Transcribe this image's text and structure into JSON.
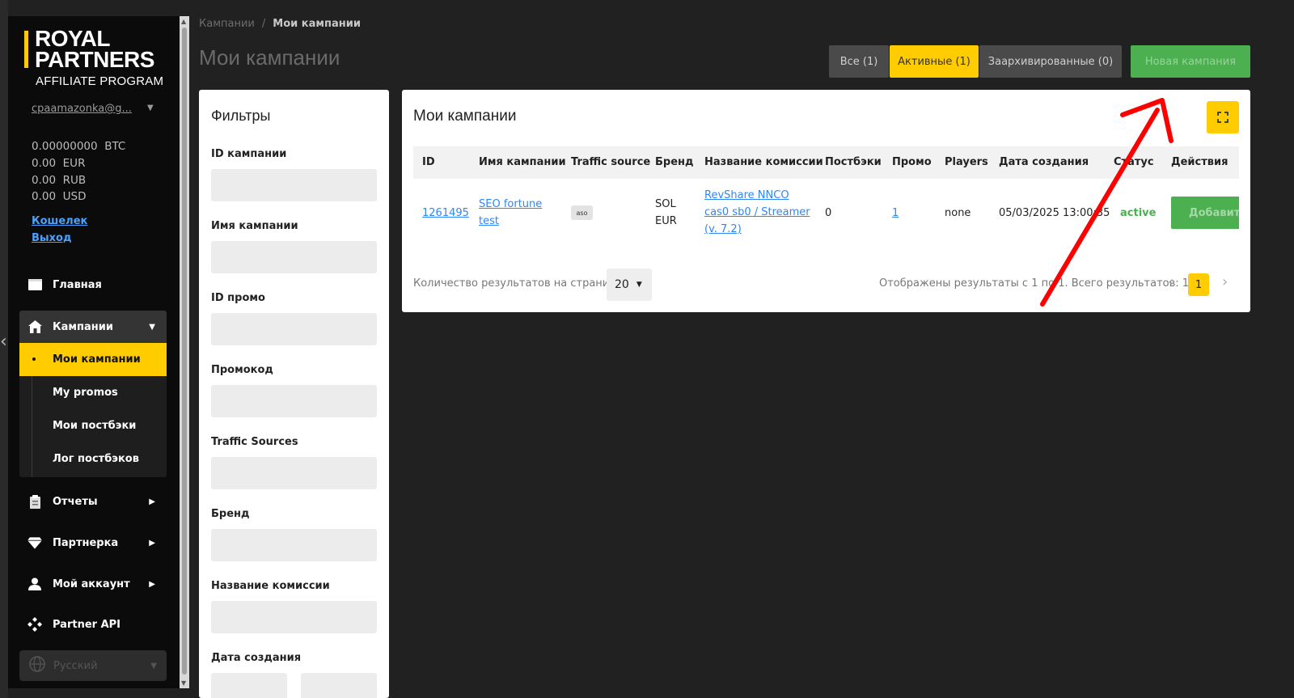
{
  "sidebar": {
    "logo": {
      "line1": "ROYAL",
      "line2": "PARTNERS",
      "line3": "AFFILIATE PROGRAM"
    },
    "user_email": "cpaamazonka@g...",
    "balances": [
      {
        "amount": "0.00000000",
        "currency": "BTC"
      },
      {
        "amount": "0.00",
        "currency": "EUR"
      },
      {
        "amount": "0.00",
        "currency": "RUB"
      },
      {
        "amount": "0.00",
        "currency": "USD"
      }
    ],
    "wallet_link": "Кошелек",
    "logout_link": "Выход",
    "nav": {
      "home": "Главная",
      "campaigns": "Кампании",
      "campaigns_sub": [
        "Мои кампании",
        "My promos",
        "Мои постбэки",
        "Лог постбэков"
      ],
      "reports": "Отчеты",
      "partner": "Партнерка",
      "account": "Мой аккаунт",
      "api": "Partner API"
    },
    "language": "Русский"
  },
  "breadcrumb": {
    "root": "Кампании",
    "separator": "/",
    "current": "Мои кампании"
  },
  "page_title": "Мои кампании",
  "status_filters": {
    "all": "Все (1)",
    "active": "Активные (1)",
    "archived": "Заархивированные (0)"
  },
  "new_campaign_button": "Новая кампания",
  "filters": {
    "title": "Фильтры",
    "fields": [
      "ID кампании",
      "Имя кампании",
      "ID промо",
      "Промокод",
      "Traffic Sources",
      "Бренд",
      "Название комиссии",
      "Дата создания"
    ]
  },
  "table_card": {
    "title": "Мои кампании",
    "columns": [
      "ID",
      "Имя кампании",
      "Traffic source",
      "Бренд",
      "Название комиссии",
      "Постбэки",
      "Промо",
      "Players",
      "Дата создания",
      "Статус",
      "Действия"
    ],
    "row": {
      "id": "1261495",
      "name_line1": "SEO fortune",
      "name_line2": "test",
      "traffic_source": "aso",
      "brand_line1": "SOL",
      "brand_line2": "EUR",
      "commission_line1": "RevShare NNCO",
      "commission_line2": "cas0 sb0 / Streamer",
      "commission_line3": "(v. 7.2)",
      "postbacks": "0",
      "promo": "1",
      "players": "none",
      "created": "05/03/2025 13:00:35",
      "status": "active",
      "action": "Добавить"
    },
    "per_page_label": "Количество результатов на странице",
    "per_page_value": "20",
    "results_text": "Отображены результаты с 1 по 1. Всего результатов: 1",
    "current_page": "1"
  },
  "colors": {
    "accent": "#ffcc00",
    "success": "#4caf50",
    "link": "#2f86f6",
    "annotation_arrow": "#ff0000"
  }
}
